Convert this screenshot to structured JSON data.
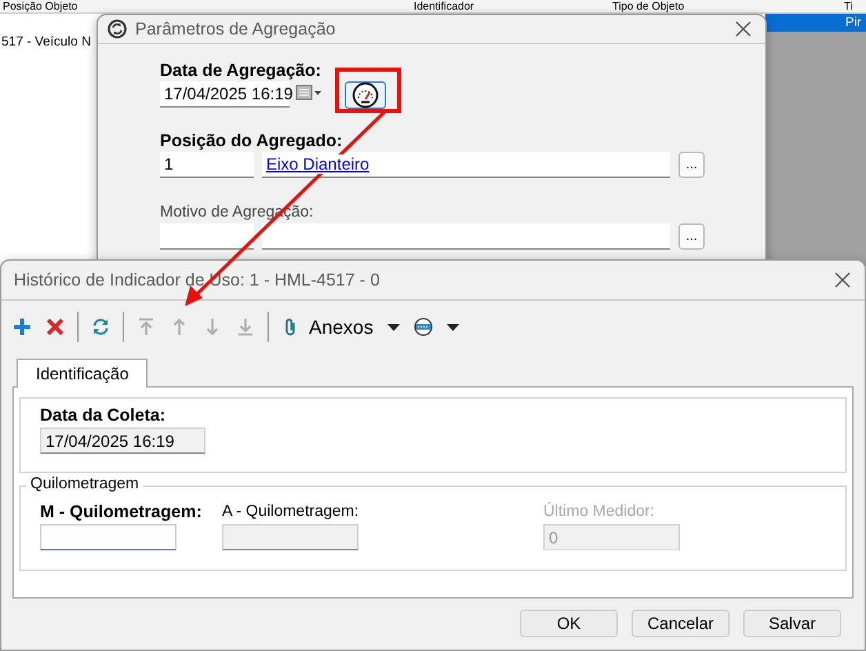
{
  "background": {
    "columns": [
      "Posição Objeto",
      "Identificador",
      "Tipo de Objeto",
      "Ti"
    ],
    "rows": [
      {
        "left": null,
        "right": "Pir",
        "selected": true
      },
      {
        "left": "517 - Veículo N",
        "right": null,
        "selected": false
      }
    ]
  },
  "aggregation_dialog": {
    "title": "Parâmetros de Agregação",
    "date": {
      "label": "Data de Agregação:",
      "value": "17/04/2025 16:19"
    },
    "position": {
      "label": "Posição do Agregado:",
      "code": "1",
      "link": "Eixo Dianteiro",
      "lookup": "..."
    },
    "reason": {
      "label": "Motivo de Agregação:",
      "lookup": "..."
    },
    "highlighted": true
  },
  "history_dialog": {
    "title": "Histórico de Indicador de Uso: 1 - HML-4517 - 0",
    "toolbar": [
      {
        "kind": "add",
        "disabled": false
      },
      {
        "kind": "delete",
        "disabled": false
      },
      {
        "kind": "separator"
      },
      {
        "kind": "refresh",
        "disabled": false
      },
      {
        "kind": "separator"
      },
      {
        "kind": "first",
        "disabled": true
      },
      {
        "kind": "up",
        "disabled": true
      },
      {
        "kind": "down",
        "disabled": true
      },
      {
        "kind": "last",
        "disabled": true
      },
      {
        "kind": "separator"
      },
      {
        "kind": "attachments",
        "label": "Anexos",
        "disabled": false
      },
      {
        "kind": "web",
        "disabled": false
      }
    ],
    "tabs": [
      {
        "label": "Identificação",
        "selected": true
      }
    ],
    "collection": {
      "label": "Data da Coleta:",
      "value": "17/04/2025 16:19"
    },
    "group": {
      "legend": "Quilometragem",
      "fields": [
        {
          "label": "M - Quilometragem:",
          "required": true,
          "disabled": false,
          "readonly": false
        },
        {
          "label": "A - Quilometragem:",
          "required": false,
          "disabled": false,
          "readonly": true
        },
        {
          "label": "Último Medidor:",
          "value": "0",
          "required": false,
          "disabled": true,
          "readonly": true
        }
      ]
    },
    "buttons": [
      "OK",
      "Cancelar",
      "Salvar"
    ]
  }
}
